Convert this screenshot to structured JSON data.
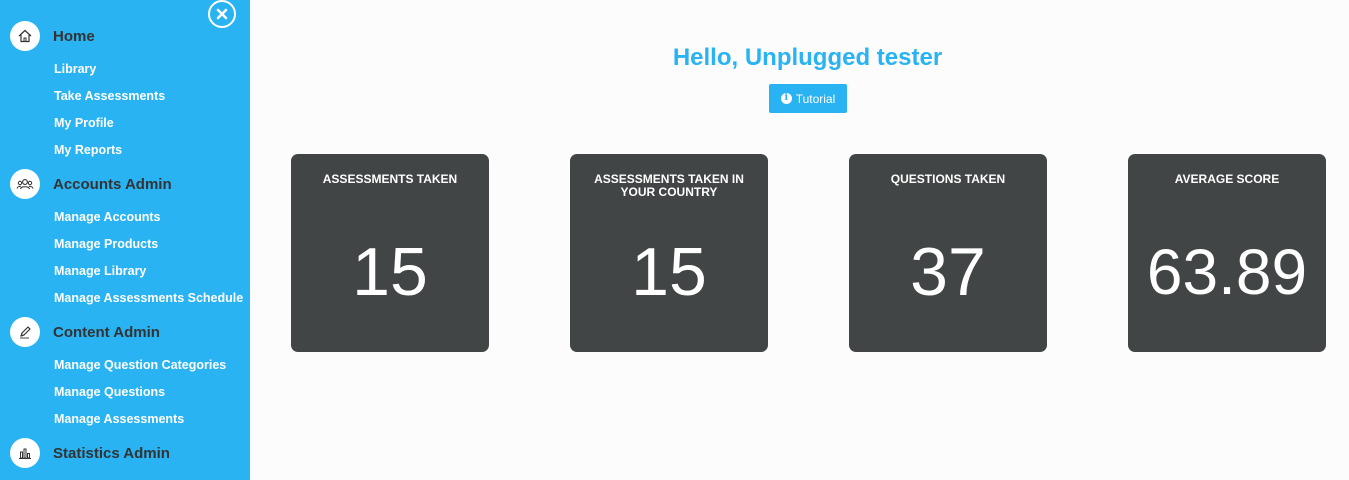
{
  "sidebar": {
    "sections": [
      {
        "label": "Home",
        "icon": "home-icon",
        "items": [
          "Library",
          "Take Assessments",
          "My Profile",
          "My Reports"
        ]
      },
      {
        "label": "Accounts Admin",
        "icon": "users-icon",
        "items": [
          "Manage Accounts",
          "Manage Products",
          "Manage Library",
          "Manage Assessments Schedule"
        ]
      },
      {
        "label": "Content Admin",
        "icon": "pencil-icon",
        "items": [
          "Manage Question Categories",
          "Manage Questions",
          "Manage Assessments"
        ]
      },
      {
        "label": "Statistics Admin",
        "icon": "bar-chart-icon",
        "items": []
      }
    ]
  },
  "main": {
    "greeting": "Hello, Unplugged tester",
    "tutorial_label": "Tutorial",
    "cards": [
      {
        "title": "ASSESSMENTS TAKEN",
        "value": "15"
      },
      {
        "title": "ASSESSMENTS TAKEN IN YOUR COUNTRY",
        "value": "15"
      },
      {
        "title": "QUESTIONS TAKEN",
        "value": "37"
      },
      {
        "title": "AVERAGE SCORE",
        "value": "63.89"
      }
    ]
  },
  "colors": {
    "accent": "#29b3f3",
    "card": "#424546"
  }
}
